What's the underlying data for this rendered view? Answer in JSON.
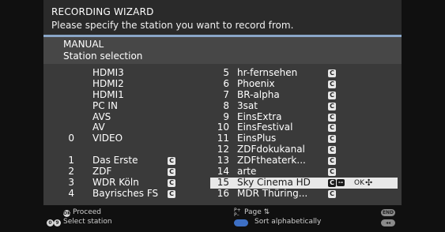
{
  "header": {
    "title": "RECORDING WIZARD",
    "subtitle": "Please specify the station you want to record from."
  },
  "panel": {
    "mode": "MANUAL",
    "section": "Station selection"
  },
  "left_list": [
    {
      "num": "",
      "name": "HDMI3",
      "c": false
    },
    {
      "num": "",
      "name": "HDMI2",
      "c": false
    },
    {
      "num": "",
      "name": "HDMI1",
      "c": false
    },
    {
      "num": "",
      "name": "PC IN",
      "c": false
    },
    {
      "num": "",
      "name": "AVS",
      "c": false
    },
    {
      "num": "",
      "name": "AV",
      "c": false
    },
    {
      "num": "0",
      "name": "VIDEO",
      "c": false
    },
    {
      "num": "",
      "name": "",
      "c": false
    },
    {
      "num": "1",
      "name": "Das Erste",
      "c": true
    },
    {
      "num": "2",
      "name": "ZDF",
      "c": true
    },
    {
      "num": "3",
      "name": "WDR Köln",
      "c": true
    },
    {
      "num": "4",
      "name": "Bayrisches FS",
      "c": true
    }
  ],
  "right_list": [
    {
      "num": "5",
      "name": "hr-fernsehen",
      "c": true
    },
    {
      "num": "6",
      "name": "Phoenix",
      "c": true
    },
    {
      "num": "7",
      "name": "BR-alpha",
      "c": true
    },
    {
      "num": "8",
      "name": "3sat",
      "c": true
    },
    {
      "num": "9",
      "name": "EinsExtra",
      "c": true
    },
    {
      "num": "10",
      "name": "EinsFestival",
      "c": true
    },
    {
      "num": "11",
      "name": "EinsPlus",
      "c": true
    },
    {
      "num": "12",
      "name": "ZDFdokukanal",
      "c": true
    },
    {
      "num": "13",
      "name": "ZDFtheaterk...",
      "c": true
    },
    {
      "num": "14",
      "name": "arte",
      "c": true
    },
    {
      "num": "15",
      "name": "Sky Cinema HD",
      "c": true,
      "selected": true
    },
    {
      "num": "16",
      "name": "MDR Thüring...",
      "c": true
    }
  ],
  "badge": {
    "c": "C",
    "key": "⊶",
    "ok": "OK",
    "nav": "✣"
  },
  "footer": {
    "proceed": "Proceed",
    "select_station": "Select station",
    "page": "Page ⇅",
    "page_icon": "P+ P–",
    "sort": "Sort alphabetically",
    "end_key": "END",
    "back_key": "◂◂",
    "ok_key": "OK",
    "num_key_0": "0",
    "num_key_9": "9"
  }
}
